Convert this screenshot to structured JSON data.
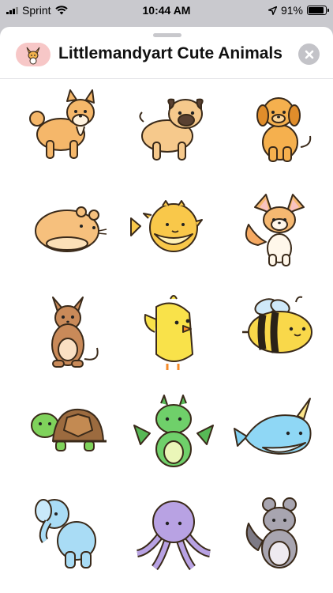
{
  "status_bar": {
    "carrier": "Sprint",
    "time": "10:44 AM",
    "battery_percent": "91%",
    "battery_level": 0.91,
    "signal_bars": 3
  },
  "header": {
    "title": "Littlemandyart Cute Animals",
    "app_icon": "fennec-fox-icon",
    "close_icon": "close-x-icon"
  },
  "stickers": [
    {
      "name": "shiba-inu-sticker"
    },
    {
      "name": "pug-sticker"
    },
    {
      "name": "golden-retriever-puppy-sticker"
    },
    {
      "name": "hamster-sticker"
    },
    {
      "name": "pufferfish-sticker"
    },
    {
      "name": "fennec-fox-sticker"
    },
    {
      "name": "kangaroo-sticker"
    },
    {
      "name": "chick-sticker"
    },
    {
      "name": "bee-sticker"
    },
    {
      "name": "turtle-sticker"
    },
    {
      "name": "dragon-sticker"
    },
    {
      "name": "narwhal-sticker"
    },
    {
      "name": "elephant-sticker"
    },
    {
      "name": "octopus-sticker"
    },
    {
      "name": "chinchilla-sticker"
    }
  ],
  "colors": {
    "sheet_background": "#ffffff",
    "backdrop": "#c9c9ce",
    "close_button": "#c3c3c8",
    "icon_background": "#f7c7c7"
  }
}
